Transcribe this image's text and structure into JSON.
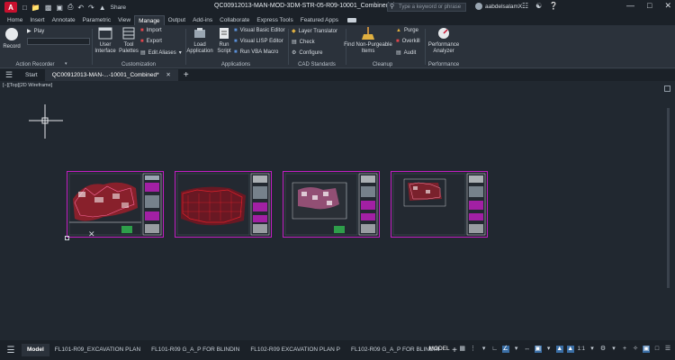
{
  "app": {
    "logo_letter": "A",
    "title": "QC00912013-MAN-MOD-3DM-STR-05-R09-10001_Combined.dwg",
    "share_label": "Share",
    "search_placeholder": "Type a keyword or phrase",
    "user_name": "aabdelsalamX..."
  },
  "ribbon_tabs": [
    "Home",
    "Insert",
    "Annotate",
    "Parametric",
    "View",
    "Manage",
    "Output",
    "Add-ins",
    "Collaborate",
    "Express Tools",
    "Featured Apps"
  ],
  "active_ribbon_tab": "Manage",
  "panels": {
    "action_recorder": {
      "title": "Action Recorder",
      "record": "Record",
      "play": "Play"
    },
    "customization": {
      "title": "Customization",
      "user_interface": "User Interface",
      "tool_palettes": "Tool Palettes",
      "import": "Import",
      "export": "Export",
      "edit_aliases": "Edit Aliases"
    },
    "applications": {
      "title": "Applications",
      "load_application": "Load Application",
      "run_script": "Run Script",
      "vba_editor": "Visual Basic Editor",
      "lisp_editor": "Visual LISP Editor",
      "run_vba": "Run VBA Macro"
    },
    "cad_standards": {
      "title": "CAD Standards",
      "layer_translator": "Layer Translator",
      "check": "Check",
      "configure": "Configure"
    },
    "cleanup": {
      "title": "Cleanup",
      "find_nonpurgeable": "Find Non-Purgeable Items",
      "purge": "Purge",
      "overkill": "Overkill",
      "audit": "Audit"
    },
    "performance": {
      "title": "Performance",
      "analyzer": "Performance Analyzer"
    }
  },
  "doc_tabs": {
    "start": "Start",
    "active": "QC00912013-MAN-...-10001_Combined*"
  },
  "viewport": {
    "label": "[−][Top][2D Wireframe]"
  },
  "layout_tabs": [
    "Model",
    "FL101-R09_EXCAVATION PLAN",
    "FL101-R09 G_A_P FOR BLINDIN",
    "FL102-R09 EXCAVATION PLAN P",
    "FL102-R09 G_A_P FOR BLINDIN"
  ],
  "status": {
    "model": "MODEL",
    "scale": "1:1"
  },
  "colors": {
    "sheet_border": "#c21ec2",
    "drawing_red": "#e0202a",
    "background": "#212830",
    "ribbon": "#2b323b"
  }
}
